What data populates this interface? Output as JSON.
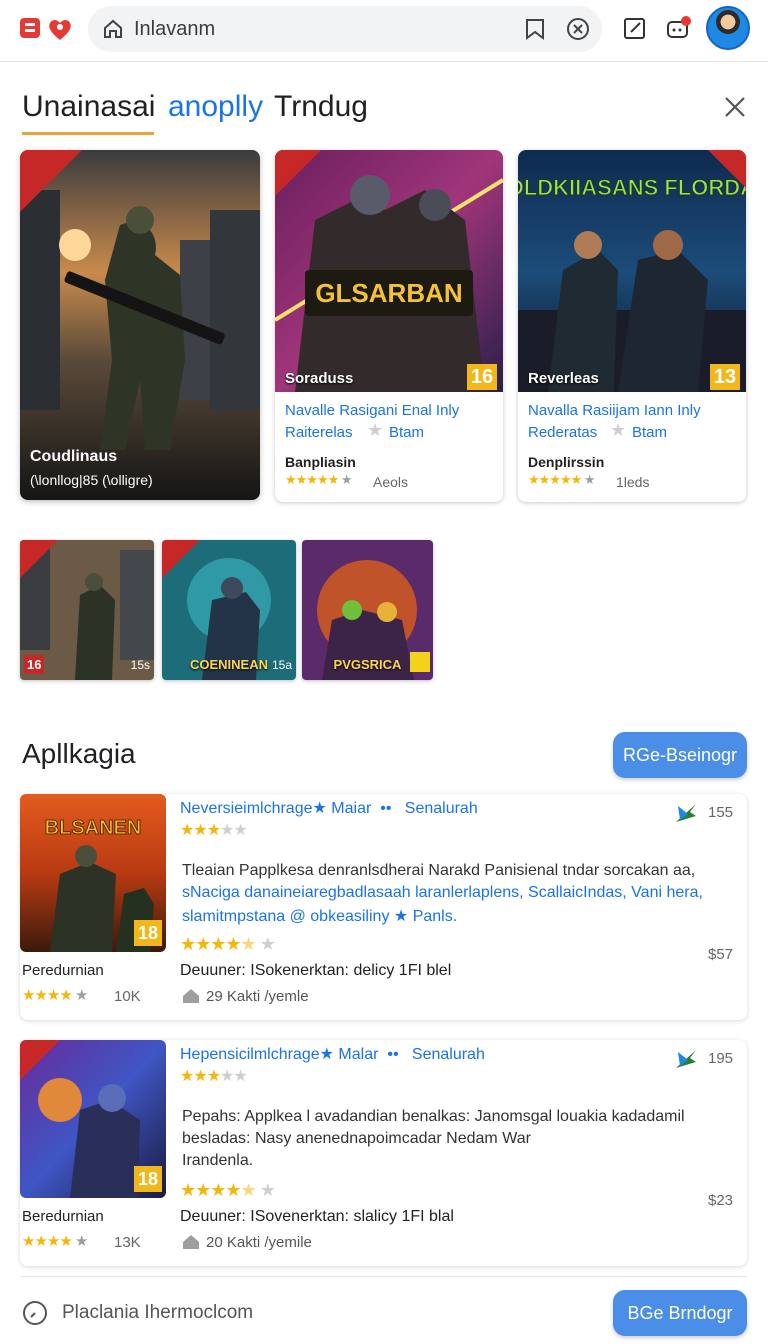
{
  "topbar": {
    "search_text": "Inlavanm"
  },
  "tabs": {
    "tab1": "Unainasai",
    "tab2": "anoplly",
    "tab3": "Trndug"
  },
  "featured": {
    "big": {
      "title": "Coudlinaus",
      "subtitle": "(\\lonllog|85 (\\olligre)"
    },
    "cards": [
      {
        "label": "Soraduss",
        "age": "16",
        "art_title": "GLSARBAN",
        "desc1": "Navalle Rasigani Enal Inly",
        "desc2a": "Raiterelas",
        "desc2b": "Btam",
        "name": "Banpliasin",
        "rating_count": "Aeols"
      },
      {
        "label": "Reverleas",
        "age": "13",
        "art_title": "UDLDKIIASANS FLORDAN",
        "desc1": "Navalla Rasiijam Iann Inly",
        "desc2a": "Rederatas",
        "desc2b": "Btam",
        "name": "Denplirssin",
        "rating_count": "1leds"
      }
    ]
  },
  "thumbs": [
    {
      "title": "",
      "age": "16",
      "small": "15s"
    },
    {
      "title": "COENINEAN",
      "age": "",
      "small": "15a"
    },
    {
      "title": "PVGSRICA",
      "age": "",
      "small": ""
    }
  ],
  "section": {
    "title": "Apllkagia",
    "top_button": "RGe-Bseinogr"
  },
  "apps": [
    {
      "publisher": "Neversieimlchrage",
      "pub_link1": "Maiar",
      "pub_link2": "Senalurah",
      "downloads": "155",
      "line1": "Tleaian Papplkesa denranlsdherai Narakd Panisienal tndar sorcakan aa,",
      "line2": "sNaciga danaineiaregbadlasaah laranlerlaplens, ScallaicIndas, Vani hera,",
      "line3": "slamitmpstana @ obkeasiliny",
      "line3b": "Panls.",
      "price": "$57",
      "name": "Peredurnian",
      "rating_count": "10K",
      "details": "Deuuner: ISokenerktan: delicy 1FI blel",
      "kk": "29 Kakti /yemle",
      "age": "18",
      "art_title": "BLSANEN"
    },
    {
      "publisher": "Hepensicilmlchrage",
      "pub_link1": "Malar",
      "pub_link2": "Senalurah",
      "downloads": "195",
      "line1": "Pepahs: Applkea l avadandian benalkas: Janomsgal louakia kadadamil",
      "line2": "besladas: Nasy anenednapoimcadar Nedam War",
      "line3": "Irandenla.",
      "line3b": "",
      "price": "$23",
      "name": "Beredurnian",
      "rating_count": "13K",
      "details": "Deuuner: ISovenerktan: slalicy 1FI blal",
      "kk": "20 Kakti /yemile",
      "age": "18",
      "art_title": ""
    }
  ],
  "bottom": {
    "text": "Placlania Ihermoclcom",
    "button": "BGe Brndogr"
  }
}
